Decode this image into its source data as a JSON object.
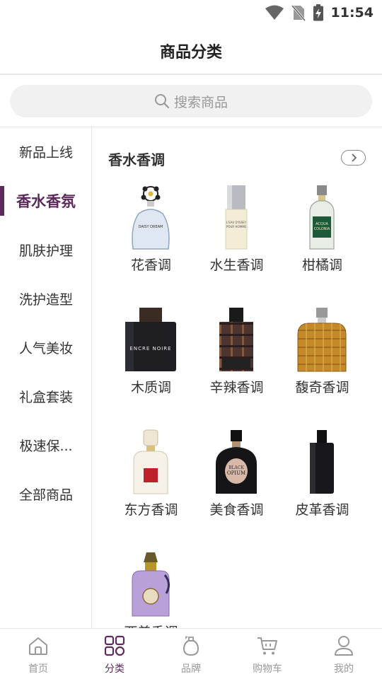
{
  "status_bar": {
    "time": "11:54"
  },
  "header": {
    "title": "商品分类"
  },
  "search": {
    "placeholder": "搜索商品"
  },
  "sidebar": {
    "items": [
      {
        "label": "新品上线",
        "active": false
      },
      {
        "label": "香水香氛",
        "active": true
      },
      {
        "label": "肌肤护理",
        "active": false
      },
      {
        "label": "洗护造型",
        "active": false
      },
      {
        "label": "人气美妆",
        "active": false
      },
      {
        "label": "礼盒套装",
        "active": false
      },
      {
        "label": "极速保...",
        "active": false
      },
      {
        "label": "全部商品",
        "active": false
      }
    ]
  },
  "content": {
    "section_title": "香水香调",
    "categories": [
      {
        "label": "花香调"
      },
      {
        "label": "水生香调"
      },
      {
        "label": "柑橘调"
      },
      {
        "label": "木质调"
      },
      {
        "label": "辛辣香调"
      },
      {
        "label": "馥奇香调"
      },
      {
        "label": "东方香调"
      },
      {
        "label": "美食香调"
      },
      {
        "label": "皮革香调"
      },
      {
        "label": "西普香调"
      }
    ],
    "bottle_text": {
      "daisy": "DAISY DREAM",
      "issey_1": "L'EAU D'ISSEY",
      "issey_2": "POUR HOMME",
      "acqua_1": "ACQUA",
      "acqua_2": "COLONIA",
      "encre": "ENCRE NOIRE",
      "opium_1": "BLACK",
      "opium_2": "OPIUM"
    }
  },
  "bottom_nav": {
    "items": [
      {
        "label": "首页",
        "icon": "home-icon"
      },
      {
        "label": "分类",
        "icon": "category-icon",
        "active": true
      },
      {
        "label": "品牌",
        "icon": "perfume-bottle-icon"
      },
      {
        "label": "购物车",
        "icon": "cart-icon"
      },
      {
        "label": "我的",
        "icon": "user-icon"
      }
    ]
  },
  "colors": {
    "accent": "#5d2b5d",
    "muted": "#999999",
    "divider": "#e6e6e6",
    "search_bg": "#f1f1f1"
  }
}
